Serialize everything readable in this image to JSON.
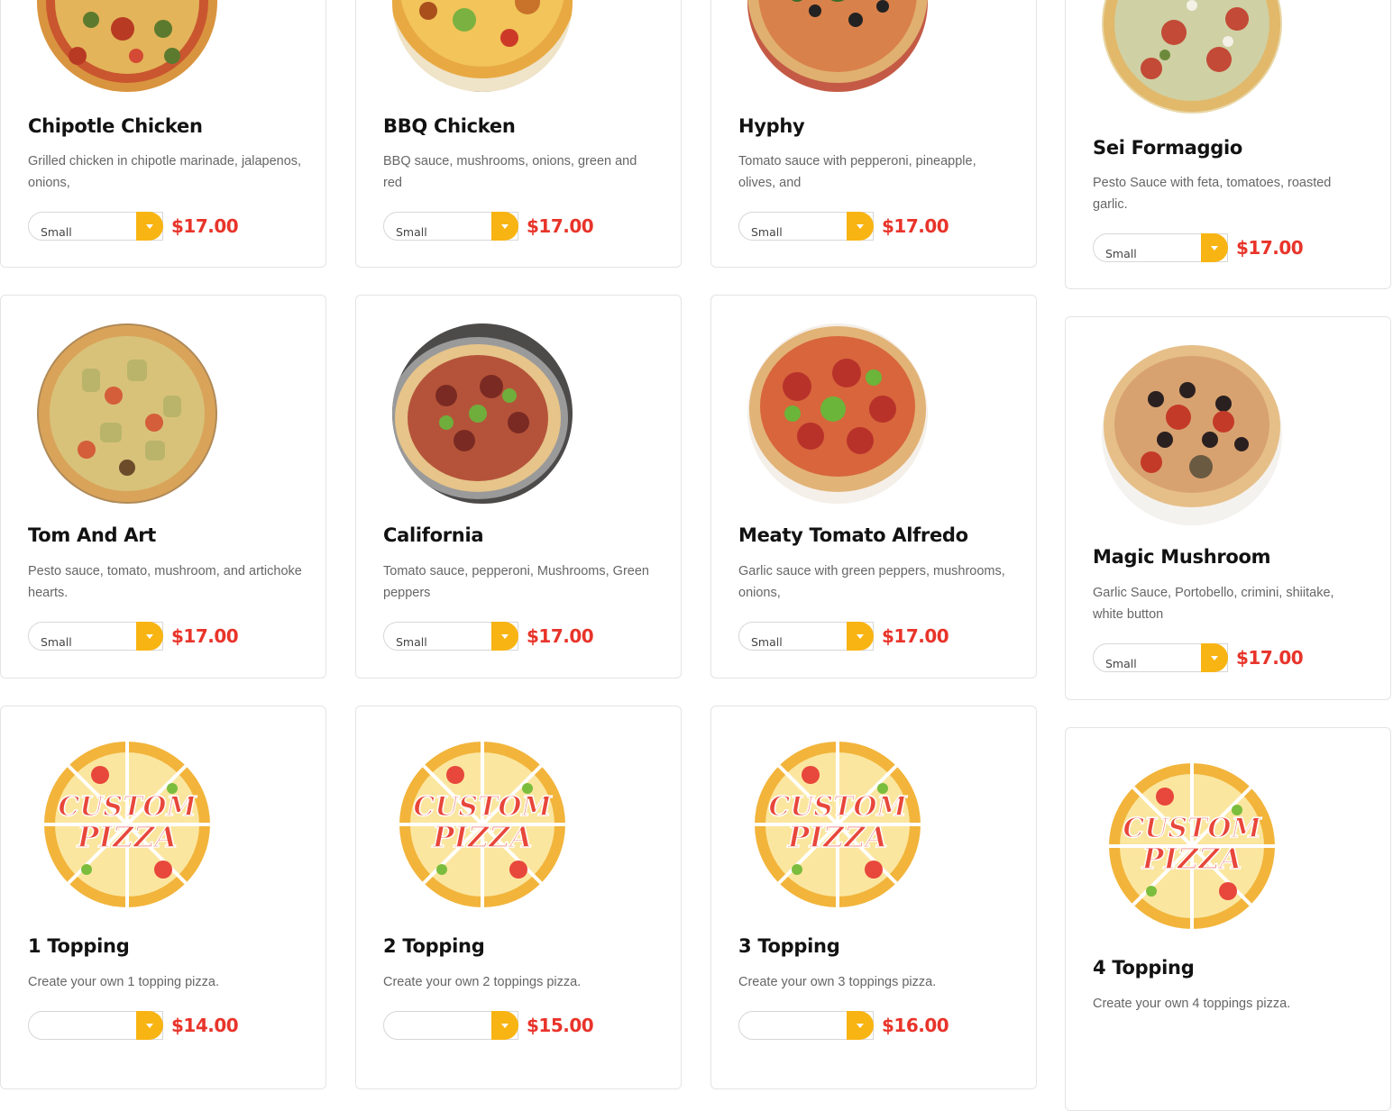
{
  "cards": [
    {
      "title": "Chipotle Chicken",
      "desc": "Grilled chicken in chipotle marinade, jalapenos, onions,",
      "size": "Small",
      "price": "$17.00",
      "image": "chipotle-chicken-pizza-image"
    },
    {
      "title": "BBQ Chicken",
      "desc": "BBQ sauce, mushrooms, onions, green and red",
      "size": "Small",
      "price": "$17.00",
      "image": "bbq-chicken-pizza-image"
    },
    {
      "title": "Hyphy",
      "desc": "Tomato sauce with pepperoni, pineapple, olives, and",
      "size": "Small",
      "price": "$17.00",
      "image": "hyphy-pizza-image"
    },
    {
      "title": "Sei Formaggio",
      "desc": "Pesto Sauce with feta, tomatoes, roasted garlic.",
      "size": "Small",
      "price": "$17.00",
      "image": "sei-formaggio-pizza-image"
    },
    {
      "title": "Tom And Art",
      "desc": "Pesto sauce, tomato, mushroom, and artichoke hearts.",
      "size": "Small",
      "price": "$17.00",
      "image": "tom-and-art-pizza-image"
    },
    {
      "title": "California",
      "desc": "Tomato sauce, pepperoni, Mushrooms, Green peppers",
      "size": "Small",
      "price": "$17.00",
      "image": "california-pizza-image"
    },
    {
      "title": "Meaty Tomato Alfredo",
      "desc": "Garlic sauce with green peppers, mushrooms, onions,",
      "size": "Small",
      "price": "$17.00",
      "image": "meaty-tomato-alfredo-pizza-image"
    },
    {
      "title": "Magic Mushroom",
      "desc": "Garlic Sauce, Portobello, crimini, shiitake, white button",
      "size": "Small",
      "price": "$17.00",
      "image": "magic-mushroom-pizza-image"
    },
    {
      "title": "1 Topping",
      "desc": "Create your own 1 topping pizza.",
      "size": "",
      "price": "$14.00",
      "image": "custom-pizza-logo"
    },
    {
      "title": "2 Topping",
      "desc": "Create your own 2 toppings pizza.",
      "size": "",
      "price": "$15.00",
      "image": "custom-pizza-logo"
    },
    {
      "title": "3 Topping",
      "desc": "Create your own 3 toppings pizza.",
      "size": "",
      "price": "$16.00",
      "image": "custom-pizza-logo"
    },
    {
      "title": "4 Topping",
      "desc": "Create your own 4 toppings pizza.",
      "size": "",
      "price": "",
      "image": "custom-pizza-logo"
    }
  ],
  "logo": {
    "line1": "CUSTOM",
    "line2": "PIZZA"
  },
  "colors": {
    "accent": "#f8b412",
    "price": "#e8342a",
    "title": "#121212",
    "text": "#666666",
    "border": "#e4e4e4"
  }
}
